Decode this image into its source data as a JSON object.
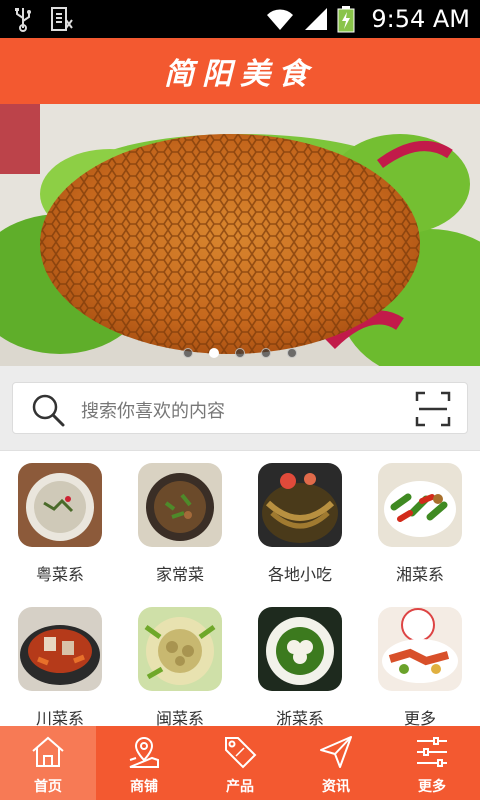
{
  "status_bar": {
    "time": "9:54 AM"
  },
  "header": {
    "title": "简阳美食"
  },
  "banner": {
    "slide_count": 5,
    "active_slide": 2
  },
  "search": {
    "placeholder": "搜索你喜欢的内容"
  },
  "categories": [
    {
      "label": "粤菜系",
      "icon": "cantonese-dish-image"
    },
    {
      "label": "家常菜",
      "icon": "home-dish-image"
    },
    {
      "label": "各地小吃",
      "icon": "snack-image"
    },
    {
      "label": "湘菜系",
      "icon": "hunan-dish-image"
    },
    {
      "label": "川菜系",
      "icon": "sichuan-dish-image"
    },
    {
      "label": "闽菜系",
      "icon": "fujian-dish-image"
    },
    {
      "label": "浙菜系",
      "icon": "zhejiang-dish-image"
    },
    {
      "label": "更多",
      "icon": "more-dish-image"
    }
  ],
  "bottom_nav": [
    {
      "label": "首页",
      "icon": "home-icon",
      "active": true
    },
    {
      "label": "商铺",
      "icon": "map-pin-icon",
      "active": false
    },
    {
      "label": "产品",
      "icon": "sale-tag-icon",
      "active": false
    },
    {
      "label": "资讯",
      "icon": "send-icon",
      "active": false
    },
    {
      "label": "更多",
      "icon": "sliders-icon",
      "active": false
    }
  ],
  "colors": {
    "brand": "#f35930",
    "nav_active": "#f77a55"
  }
}
